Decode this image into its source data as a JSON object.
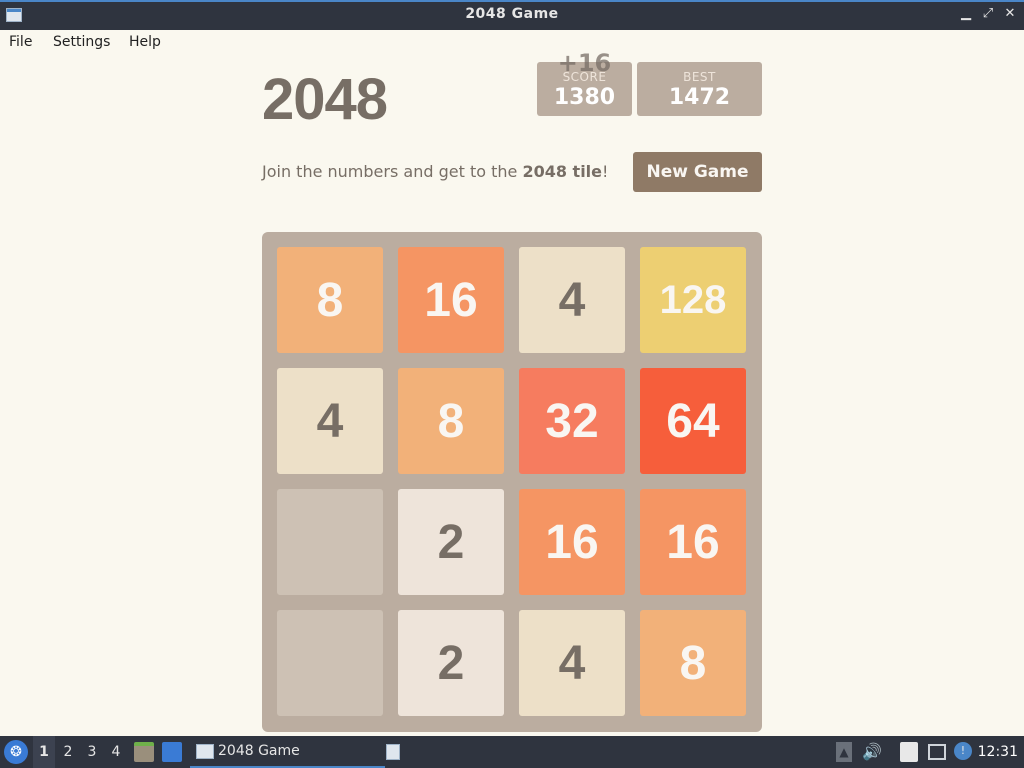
{
  "window": {
    "title": "2048 Game"
  },
  "menu": [
    "File",
    "Settings",
    "Help"
  ],
  "game": {
    "heading": "2048",
    "score_label": "SCORE",
    "score_value": "1380",
    "score_add": "+16",
    "best_label": "BEST",
    "best_value": "1472",
    "intro_prefix": "Join the numbers and get to the ",
    "intro_bold": "2048 tile",
    "intro_suffix": "!",
    "new_game_label": "New Game"
  },
  "board": [
    [
      "8",
      "16",
      "4",
      "128"
    ],
    [
      "4",
      "8",
      "32",
      "64"
    ],
    [
      "",
      "2",
      "16",
      "16"
    ],
    [
      "",
      "2",
      "4",
      "8"
    ]
  ],
  "tile_colors": {
    "": {
      "bg": "#cdc1b4",
      "fg": "#776e65"
    },
    "2": {
      "bg": "#eee4da",
      "fg": "#776e65"
    },
    "4": {
      "bg": "#ede0c8",
      "fg": "#776e65"
    },
    "8": {
      "bg": "#f2b179",
      "fg": "#f9f6f2"
    },
    "16": {
      "bg": "#f59563",
      "fg": "#f9f6f2"
    },
    "32": {
      "bg": "#f67c5f",
      "fg": "#f9f6f2"
    },
    "64": {
      "bg": "#f65e3b",
      "fg": "#f9f6f2"
    },
    "128": {
      "bg": "#edcf72",
      "fg": "#f9f6f2"
    }
  },
  "taskbar": {
    "workspaces": [
      "1",
      "2",
      "3",
      "4"
    ],
    "active_workspace": "1",
    "task_label": "2048 Game",
    "clock": "12:31",
    "tray_icons": [
      "up-arrow-icon",
      "volume-icon",
      "clipboard-icon",
      "network-icon",
      "notification-icon"
    ]
  }
}
